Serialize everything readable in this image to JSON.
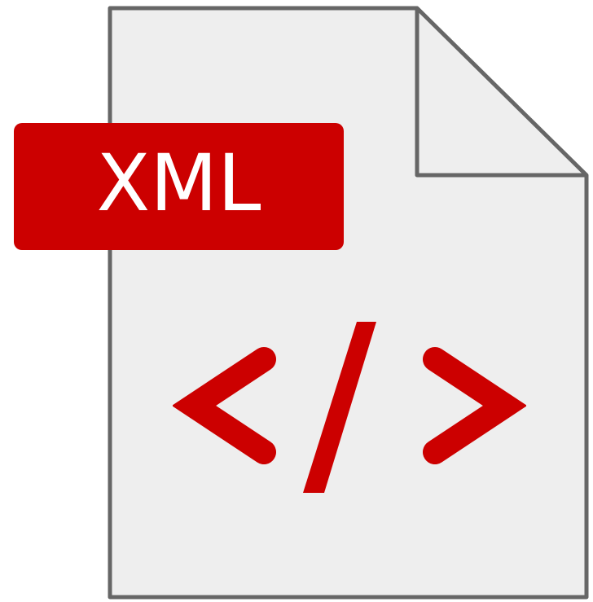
{
  "icon": {
    "name": "xml-file-icon",
    "badge_label": "XML",
    "code_symbol": "</>",
    "colors": {
      "accent": "#cc0000",
      "page_fill": "#eeeeee",
      "page_outline": "#666666",
      "badge_text": "#ffffff"
    }
  }
}
